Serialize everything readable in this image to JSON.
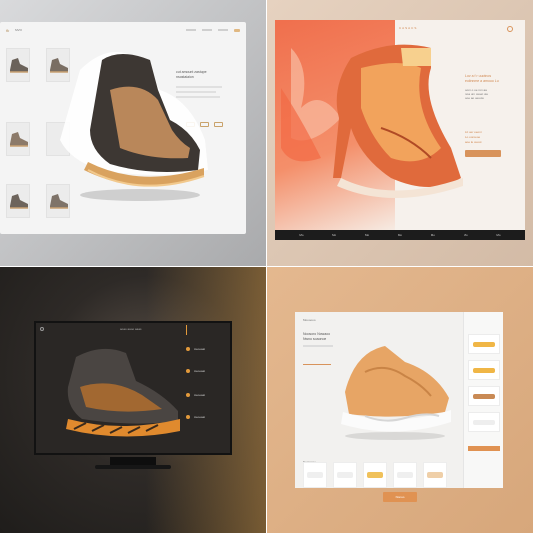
{
  "q1": {
    "logo": "fk",
    "brand": "MVO",
    "headline": "cut amount zastupe",
    "subhead": "nsostaiaion",
    "accent": "#c9a26a"
  },
  "q2": {
    "brand": "CASACS",
    "headline": "Lov a f r uuotnos",
    "subhead": "eoiinnme a amouo Lu",
    "body_lines": [
      "oom o ue ron aa",
      "noa um osoet uie",
      "ooe ao ueuuw"
    ],
    "links": [
      "Lit uer oeoni",
      "Lo ooroeoe",
      "aoe le ouoot"
    ],
    "footer_items": [
      "Mo",
      "Mo",
      "Mo",
      "Mo",
      "Mo",
      "Mo",
      "Mo"
    ],
    "accent": "#d8935b"
  },
  "q3": {
    "nav": "aoao aaoo aaas",
    "feature_labels": [
      "Aeoeaat",
      "Aeoeaat",
      "Aeoeaat",
      "Aeoeaat"
    ],
    "accent": "#e39a3b"
  },
  "q4": {
    "brand": "Moooooo",
    "headline": "Noosoro Nowaoo",
    "subhead": "Nwno soaonoe",
    "cta": "Nonoo",
    "section_title": "Noamnoe",
    "accent": "#e09252"
  },
  "icons": [
    "search-icon",
    "cart-icon",
    "menu-icon",
    "logo-icon"
  ]
}
